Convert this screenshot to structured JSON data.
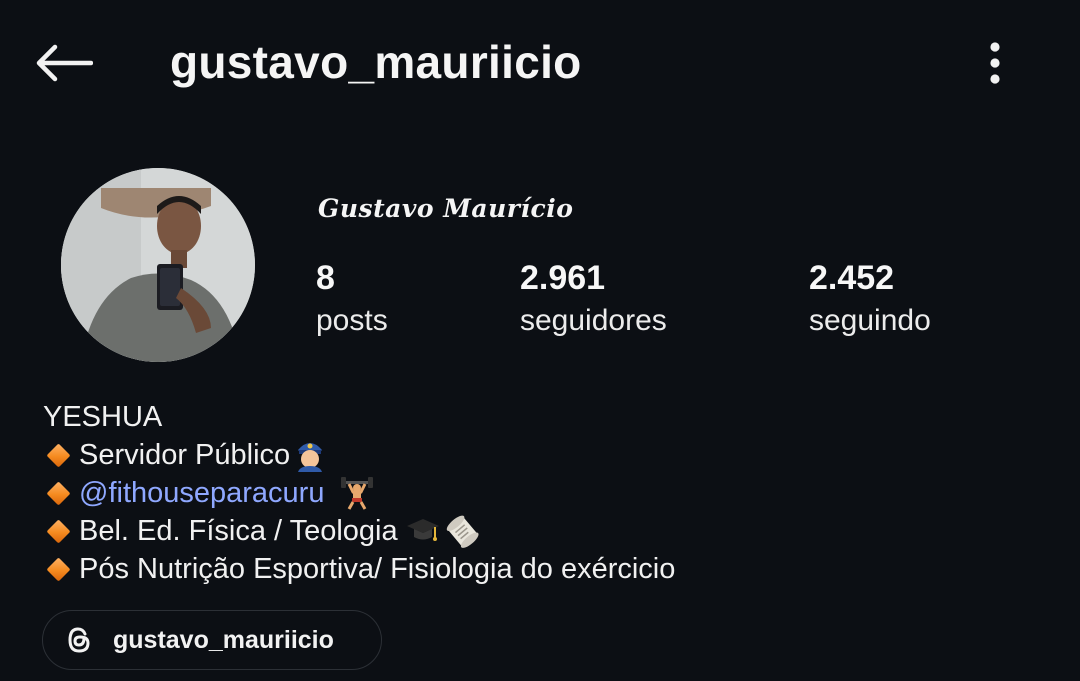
{
  "header": {
    "username": "gustavo_mauriicio",
    "back_icon": "arrow-left-icon",
    "menu_icon": "more-vertical-icon"
  },
  "profile": {
    "display_name": "Gustavo Maurício",
    "stats": [
      {
        "value": "8",
        "label": "posts"
      },
      {
        "value": "2.961",
        "label": "seguidores"
      },
      {
        "value": "2.452",
        "label": "seguindo"
      }
    ]
  },
  "bio": {
    "line1": "YESHUA",
    "line2": "Servidor Público",
    "line3_mention": "@fithouseparacuru",
    "line4": "Bel. Ed. Física / Teologia",
    "line5": "Pós Nutrição Esportiva/ Fisiologia do exércicio",
    "bullet_icon": "orange-diamond-icon",
    "colors": {
      "mention": "#8fa8ff",
      "bullet": "#f58a1f"
    }
  },
  "threads": {
    "label": "gustavo_mauriicio",
    "icon": "threads-icon"
  },
  "colors": {
    "background": "#0c0f14",
    "text": "#f2f2f2"
  }
}
